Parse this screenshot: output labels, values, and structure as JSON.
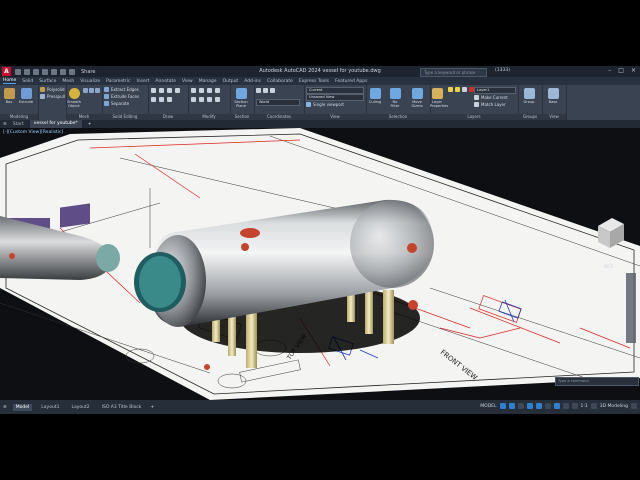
{
  "app": {
    "logo": "A",
    "title": "Autodesk AutoCAD 2024   vessel for youtube.dwg",
    "share_label": "Share",
    "search_placeholder": "Type a keyword or phrase",
    "user_label": "(1333)"
  },
  "menu_tabs": [
    "Home",
    "Solid",
    "Surface",
    "Mesh",
    "Visualize",
    "Parametric",
    "Insert",
    "Annotate",
    "View",
    "Manage",
    "Output",
    "Add-ins",
    "Collaborate",
    "Express Tools",
    "Featured Apps"
  ],
  "ribbon": {
    "modeling": {
      "title": "Modeling",
      "box": "Box",
      "extrude": "Extrude",
      "polysolid": "Polysolid",
      "presspull": "Presspull",
      "smooth_object": "Smooth Object"
    },
    "mesh": {
      "title": "Mesh"
    },
    "solid_editing": {
      "title": "Solid Editing",
      "extract_edges": "Extract Edges",
      "extrude_faces": "Extrude Faces",
      "separate": "Separate"
    },
    "draw": {
      "title": "Draw"
    },
    "modify": {
      "title": "Modify"
    },
    "section": {
      "title": "Section",
      "section_plane": "Section Plane"
    },
    "coordinates": {
      "title": "Coordinates",
      "world": "World"
    },
    "view": {
      "title": "View",
      "visual_style": "Current",
      "view_name": "Unsaved View",
      "viewport": "Single viewport"
    },
    "selection": {
      "title": "Selection",
      "culling": "Culling",
      "no_filter": "No Filter",
      "move_gizmo": "Move Gizmo"
    },
    "layers": {
      "title": "Layers",
      "layer_properties": "Layer Properties",
      "layer_name": "Layer1",
      "make_current": "Make Current",
      "match_layer": "Match Layer"
    },
    "groups": {
      "title": "Groups",
      "group": "Group"
    },
    "view2": {
      "title": "View",
      "base": "Base"
    }
  },
  "doc_tabs": {
    "start": "Start",
    "active": "vessel for youtube*"
  },
  "viewport": {
    "label": "[-][Custom View][Realistic]",
    "view_labels": {
      "front_view": "FRONT VIEW",
      "top_view": "TOP VIEW"
    },
    "viewcube_label": "WCS"
  },
  "command_line": {
    "placeholder": "Type a command"
  },
  "status": {
    "layouts": [
      "Model",
      "Layout1",
      "Layout2",
      "ISO A3 Title Block"
    ],
    "mode": "MODEL",
    "scale": "1:1",
    "workspace": "3D Modeling"
  },
  "colors": {
    "accent": "#2f7fcf",
    "brand": "#c8102e",
    "drawing_red": "#e0211d",
    "drawing_blue": "#1e3cc8"
  }
}
